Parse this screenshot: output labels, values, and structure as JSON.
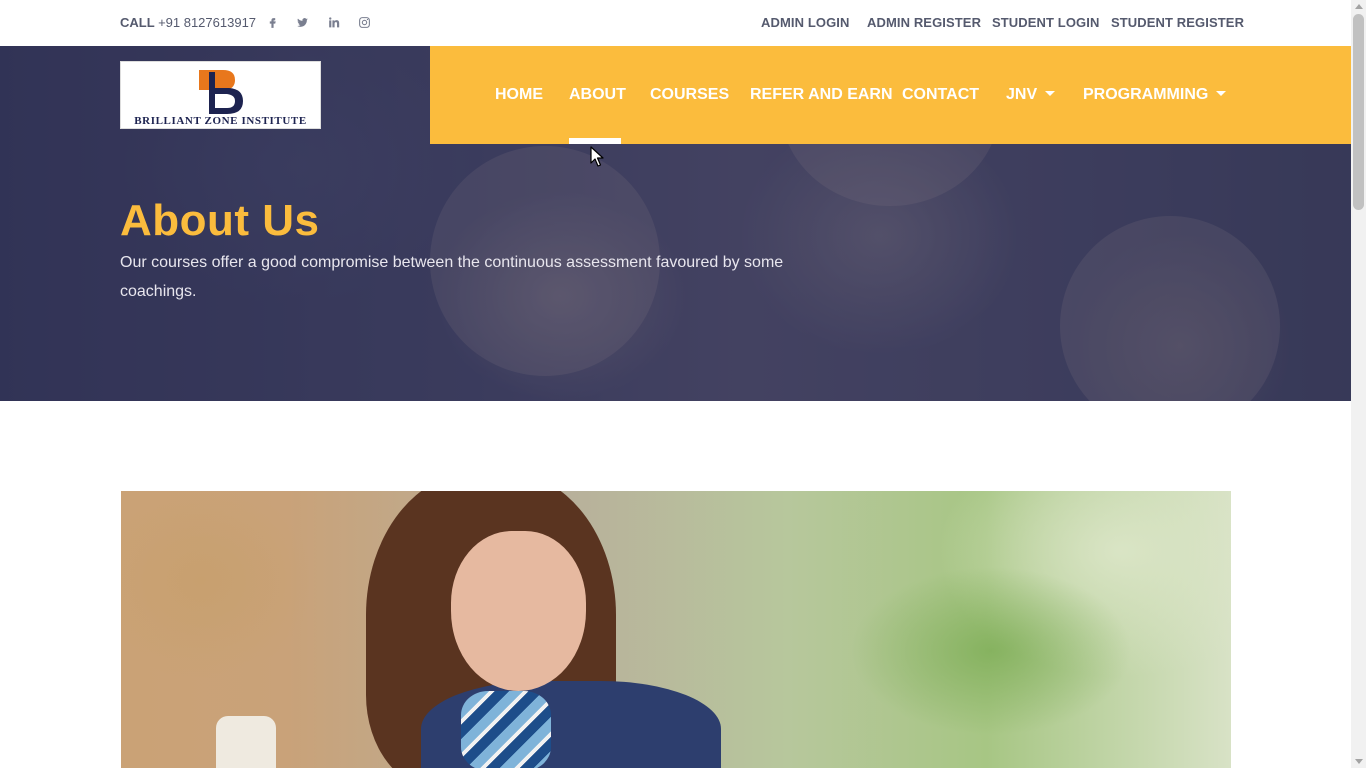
{
  "topbar": {
    "call_label": "CALL",
    "phone": "+91 8127613917",
    "social": [
      "facebook-icon",
      "twitter-icon",
      "linkedin-icon",
      "instagram-icon"
    ],
    "links": [
      "ADMIN LOGIN",
      "ADMIN REGISTER",
      "STUDENT LOGIN",
      "STUDENT REGISTER"
    ]
  },
  "logo": {
    "mark": "B",
    "text": "BRILLIANT ZONE INSTITUTE"
  },
  "nav": {
    "items": [
      "HOME",
      "ABOUT",
      "COURSES",
      "REFER AND EARN",
      "CONTACT",
      "JNV",
      "PROGRAMMING"
    ],
    "active": "ABOUT"
  },
  "hero": {
    "title": "About Us",
    "subtitle": "Our courses offer a good compromise between the continuous assessment favoured by some coachings."
  },
  "colors": {
    "accent": "#fbbc3d",
    "text_dark": "#555a6e",
    "hero_overlay": "#2a2c50"
  }
}
